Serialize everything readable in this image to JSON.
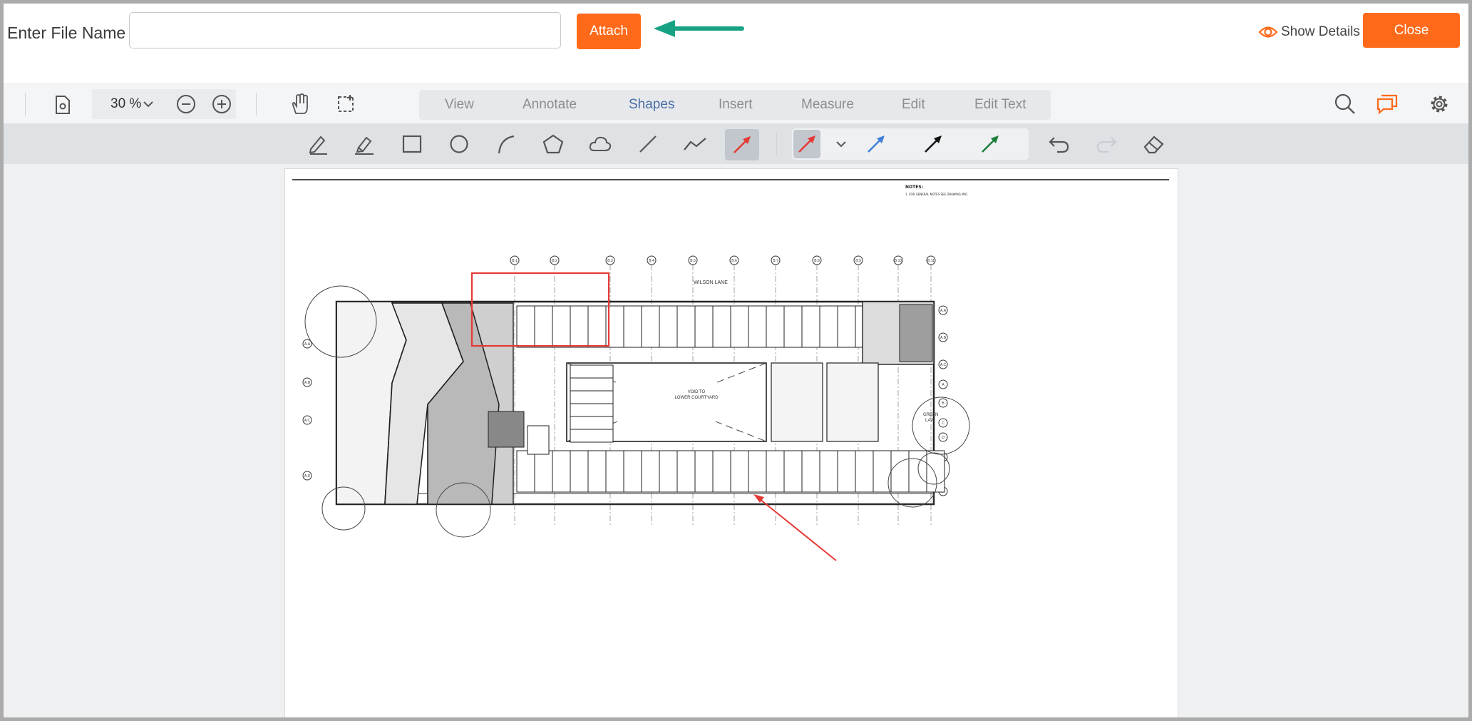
{
  "header": {
    "file_name_label": "Enter File Name",
    "file_name_value": "",
    "attach_label": "Attach",
    "show_details_label": "Show Details",
    "close_label": "Close"
  },
  "toolbar": {
    "zoom": "30 %",
    "tabs": [
      {
        "label": "View",
        "active": false
      },
      {
        "label": "Annotate",
        "active": false
      },
      {
        "label": "Shapes",
        "active": true
      },
      {
        "label": "Insert",
        "active": false
      },
      {
        "label": "Measure",
        "active": false
      },
      {
        "label": "Edit",
        "active": false
      },
      {
        "label": "Edit Text",
        "active": false
      }
    ]
  },
  "shape_tools": [
    "pen-icon",
    "highlighter-icon",
    "rectangle-icon",
    "ellipse-icon",
    "arc-icon",
    "polygon-icon",
    "cloud-icon",
    "line-icon",
    "polyline-icon",
    "arrow-icon"
  ],
  "arrow_colors": [
    "#e53935",
    "#3f7fd9",
    "#111111",
    "#1b7f3a"
  ],
  "colors": {
    "accent": "#ff6a1a",
    "active_tab": "#4a6fa8",
    "annotation_red": "#e53935",
    "callout_green": "#17a383"
  },
  "drawing": {
    "notes_title": "NOTES:",
    "notes_line": "1.   FOR GENERAL NOTES SEE DRAWING M01",
    "street": "WILSON LANE",
    "void_label_1": "VOID TO",
    "void_label_2": "LOWER COURTYARD",
    "green_label_1": "GREEN",
    "green_label_2": "LAW",
    "grid_top": [
      "B.1",
      "B.2",
      "B.3",
      "B.4",
      "B.5",
      "B.6",
      "B.7",
      "B.8",
      "B.9",
      "B.10",
      "B.11"
    ],
    "grid_right": [
      "A.A",
      "A.B",
      "A.C",
      "A",
      "B",
      "C",
      "D",
      "E",
      "F"
    ],
    "grid_left": [
      "A.A",
      "A.B",
      "A.C",
      "A.D"
    ]
  }
}
